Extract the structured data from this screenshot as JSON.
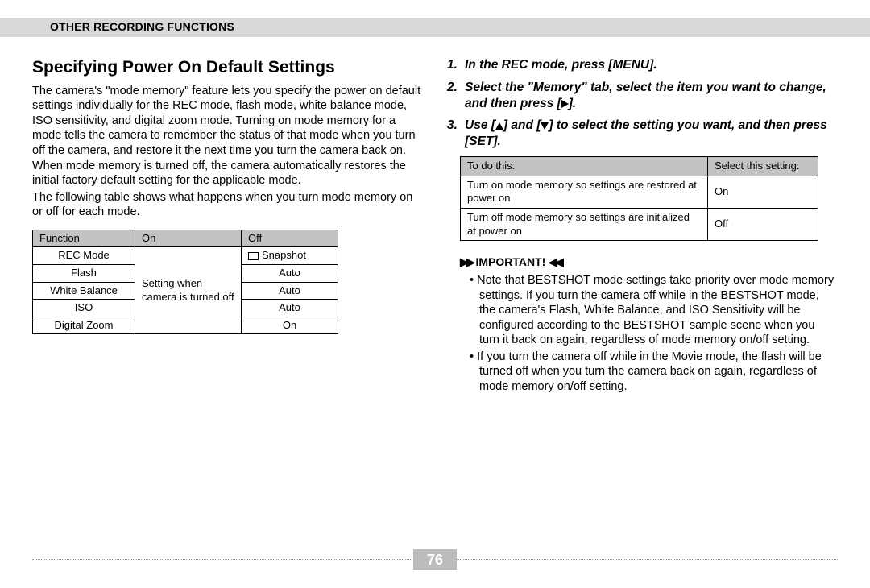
{
  "header": {
    "section": "OTHER RECORDING FUNCTIONS"
  },
  "title": "Specifying Power On Default Settings",
  "para1": "The camera's \"mode memory\" feature lets you specify the power on default settings individually for the REC mode, flash mode, white balance mode, ISO sensitivity, and digital zoom mode. Turning on mode memory for a mode tells the camera to remember the status of that mode when you turn off the camera, and restore it the next time you turn the camera back on. When mode memory is turned off, the camera automatically restores the initial factory default setting for the applicable mode.",
  "para2": "The following table shows what happens when you turn mode memory on or off for each mode.",
  "table1": {
    "head": {
      "c1": "Function",
      "c2": "On",
      "c3": "Off"
    },
    "onMerged": "Setting when camera is turned off",
    "rows": [
      {
        "fn": "REC Mode",
        "off": "Snapshot",
        "offHasIcon": true
      },
      {
        "fn": "Flash",
        "off": "Auto"
      },
      {
        "fn": "White Balance",
        "off": "Auto"
      },
      {
        "fn": "ISO",
        "off": "Auto"
      },
      {
        "fn": "Digital Zoom",
        "off": "On"
      }
    ]
  },
  "steps": {
    "s1_num": "1.",
    "s1": "In the REC mode, press [MENU].",
    "s2_num": "2.",
    "s2a": "Select the \"Memory\" tab, select the item you want to change, and then press [",
    "s2b": "].",
    "s3_num": "3.",
    "s3a": "Use [",
    "s3b": "] and [",
    "s3c": "] to select the setting you want, and then press [SET]."
  },
  "table2": {
    "h1": "To do this:",
    "h2": "Select this setting:",
    "r1a": "Turn on mode memory so settings are restored at power on",
    "r1b": "On",
    "r2a": "Turn off mode memory so settings are initialized at power on",
    "r2b": "Off"
  },
  "important": {
    "label": "IMPORTANT!",
    "iconL": "▶▶",
    "iconR": "◀◀",
    "n1": "Note that BESTSHOT mode settings take priority over mode memory settings. If you turn the camera off while in the BESTSHOT mode, the camera's Flash, White Balance, and ISO Sensitivity will be configured according to the BESTSHOT sample scene when you turn it back on again, regardless of mode memory on/off setting.",
    "n2": "If you turn the camera off while in the Movie mode, the flash will be turned off when you turn the camera back on again, regardless of mode memory on/off setting."
  },
  "pageNumber": "76"
}
